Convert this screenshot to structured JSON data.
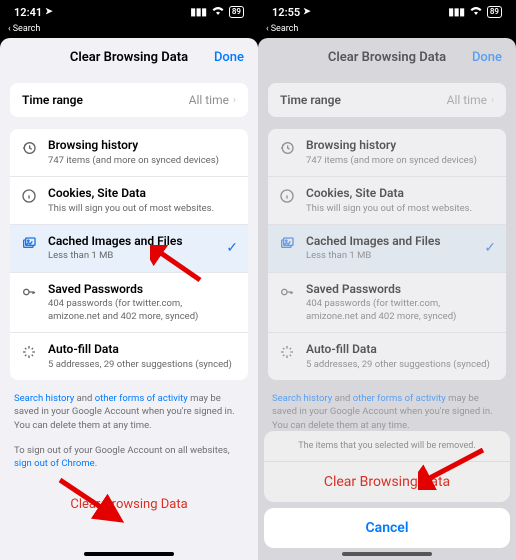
{
  "left": {
    "status": {
      "time": "12:41",
      "battery": "89"
    },
    "back": "Search",
    "title": "Clear Browsing Data",
    "done": "Done",
    "timerange": {
      "label": "Time range",
      "value": "All time"
    },
    "items": [
      {
        "title": "Browsing history",
        "sub": "747 items (and more on synced devices)"
      },
      {
        "title": "Cookies, Site Data",
        "sub": "This will sign you out of most websites."
      },
      {
        "title": "Cached Images and Files",
        "sub": "Less than 1 MB"
      },
      {
        "title": "Saved Passwords",
        "sub": "404 passwords (for twitter.com, amizone.net and 402 more, synced)"
      },
      {
        "title": "Auto-fill Data",
        "sub": "5 addresses, 29 other suggestions (synced)"
      }
    ],
    "footer1a": "Search history",
    "footer1b": " and ",
    "footer1c": "other forms of activity",
    "footer1d": " may be saved in your Google Account when you're signed in. You can delete them at any time.",
    "footer2a": "To sign out of your Google Account on all websites, ",
    "footer2b": "sign out of Chrome",
    "footer2c": ".",
    "cbd": "Clear Browsing Data"
  },
  "right": {
    "status": {
      "time": "12:55",
      "battery": "89"
    },
    "back": "Search",
    "title": "Clear Browsing Data",
    "done": "Done",
    "timerange": {
      "label": "Time range",
      "value": "All time"
    },
    "items": [
      {
        "title": "Browsing history",
        "sub": "747 items (and more on synced devices)"
      },
      {
        "title": "Cookies, Site Data",
        "sub": "This will sign you out of most websites."
      },
      {
        "title": "Cached Images and Files",
        "sub": "Less than 1 MB"
      },
      {
        "title": "Saved Passwords",
        "sub": "404 passwords (for twitter.com, amizone.net and 402 more, synced)"
      },
      {
        "title": "Auto-fill Data",
        "sub": "5 addresses, 29 other suggestions (synced)"
      }
    ],
    "footer1a": "Search history",
    "footer1b": " and ",
    "footer1c": "other forms of activity",
    "footer1d": " may be saved in your Google Account when you're signed in. You can delete them at any time.",
    "actionsheet": {
      "msg": "The items that you selected will be removed.",
      "action": "Clear Browsing Data",
      "cancel": "Cancel"
    }
  }
}
